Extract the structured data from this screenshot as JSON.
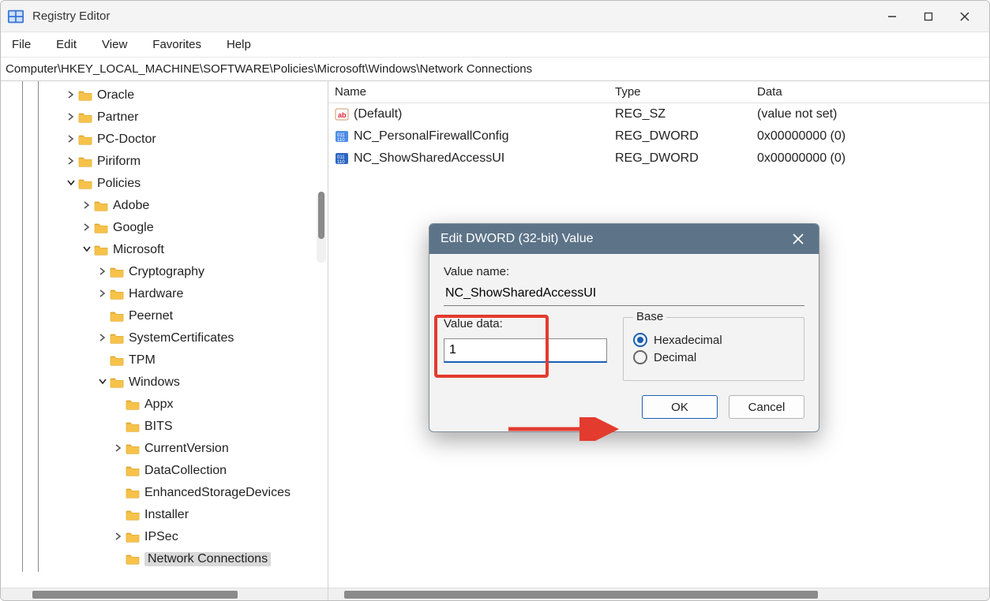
{
  "titlebar": {
    "title": "Registry Editor"
  },
  "menubar": [
    "File",
    "Edit",
    "View",
    "Favorites",
    "Help"
  ],
  "address": "Computer\\HKEY_LOCAL_MACHINE\\SOFTWARE\\Policies\\Microsoft\\Windows\\Network Connections",
  "tree": [
    {
      "indent": 2,
      "chev": "right",
      "label": "Oracle"
    },
    {
      "indent": 2,
      "chev": "right",
      "label": "Partner"
    },
    {
      "indent": 2,
      "chev": "right",
      "label": "PC-Doctor"
    },
    {
      "indent": 2,
      "chev": "right",
      "label": "Piriform"
    },
    {
      "indent": 2,
      "chev": "down",
      "label": "Policies"
    },
    {
      "indent": 3,
      "chev": "right",
      "label": "Adobe"
    },
    {
      "indent": 3,
      "chev": "right",
      "label": "Google"
    },
    {
      "indent": 3,
      "chev": "down",
      "label": "Microsoft"
    },
    {
      "indent": 4,
      "chev": "right",
      "label": "Cryptography"
    },
    {
      "indent": 4,
      "chev": "right",
      "label": "Hardware"
    },
    {
      "indent": 4,
      "chev": "none",
      "label": "Peernet"
    },
    {
      "indent": 4,
      "chev": "right",
      "label": "SystemCertificates"
    },
    {
      "indent": 4,
      "chev": "none",
      "label": "TPM"
    },
    {
      "indent": 4,
      "chev": "down",
      "label": "Windows"
    },
    {
      "indent": 5,
      "chev": "none",
      "label": "Appx"
    },
    {
      "indent": 5,
      "chev": "none",
      "label": "BITS"
    },
    {
      "indent": 5,
      "chev": "right",
      "label": "CurrentVersion"
    },
    {
      "indent": 5,
      "chev": "none",
      "label": "DataCollection"
    },
    {
      "indent": 5,
      "chev": "none",
      "label": "EnhancedStorageDevices"
    },
    {
      "indent": 5,
      "chev": "none",
      "label": "Installer"
    },
    {
      "indent": 5,
      "chev": "right",
      "label": "IPSec"
    },
    {
      "indent": 5,
      "chev": "none",
      "label": "Network Connections",
      "selected": true
    }
  ],
  "list": {
    "headers": {
      "name": "Name",
      "type": "Type",
      "data": "Data"
    },
    "rows": [
      {
        "icon": "string",
        "name": "(Default)",
        "type": "REG_SZ",
        "data": "(value not set)"
      },
      {
        "icon": "dword",
        "name": "NC_PersonalFirewallConfig",
        "type": "REG_DWORD",
        "data": "0x00000000 (0)"
      },
      {
        "icon": "dword",
        "name": "NC_ShowSharedAccessUI",
        "type": "REG_DWORD",
        "data": "0x00000000 (0)",
        "selected": true
      }
    ]
  },
  "dialog": {
    "title": "Edit DWORD (32-bit) Value",
    "value_name_label": "Value name:",
    "value_name": "NC_ShowSharedAccessUI",
    "value_data_label": "Value data:",
    "value_data": "1",
    "base_label": "Base",
    "hex_label": "Hexadecimal",
    "dec_label": "Decimal",
    "ok": "OK",
    "cancel": "Cancel"
  }
}
